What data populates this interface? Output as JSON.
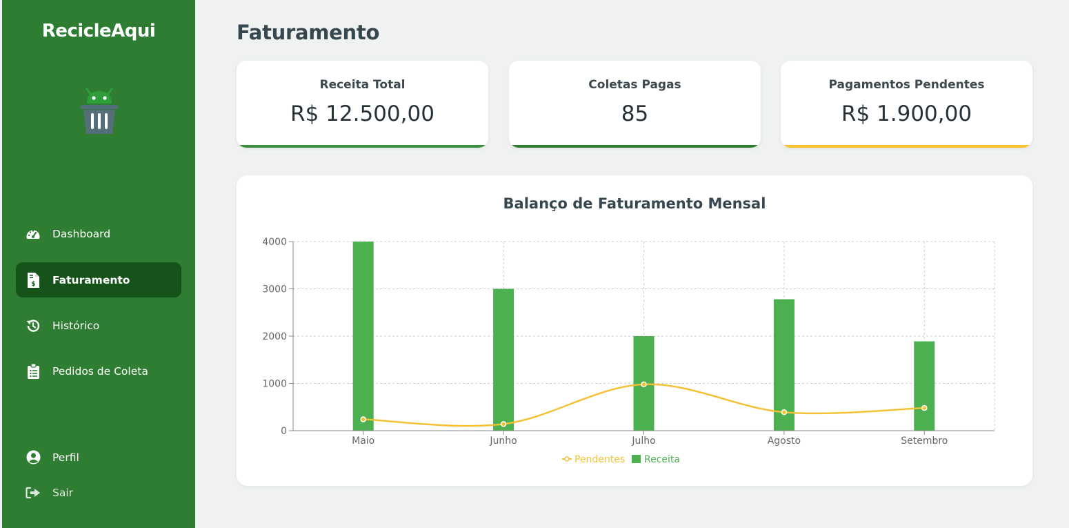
{
  "app": {
    "brand": "RecicleAqui"
  },
  "sidebar": {
    "items": [
      {
        "label": "Dashboard",
        "icon": "gauge-icon"
      },
      {
        "label": "Faturamento",
        "icon": "invoice-icon",
        "active": true
      },
      {
        "label": "Histórico",
        "icon": "history-icon"
      },
      {
        "label": "Pedidos de Coleta",
        "icon": "clipboard-list-icon"
      }
    ],
    "bottom": [
      {
        "label": "Perfil",
        "icon": "user-circle-icon"
      },
      {
        "label": "Sair",
        "icon": "sign-out-icon"
      }
    ]
  },
  "page": {
    "title": "Faturamento"
  },
  "cards": [
    {
      "title": "Receita Total",
      "value": "R$ 12.500,00",
      "accent": "#388e3c"
    },
    {
      "title": "Coletas Pagas",
      "value": "85",
      "accent": "#2e7d32"
    },
    {
      "title": "Pagamentos Pendentes",
      "value": "R$ 1.900,00",
      "accent": "#fbc02d"
    }
  ],
  "chart_data": {
    "type": "bar",
    "title": "Balanço de Faturamento Mensal",
    "categories": [
      "Maio",
      "Junho",
      "Julho",
      "Agosto",
      "Setembro"
    ],
    "series": [
      {
        "name": "Receita",
        "type": "bar",
        "color": "#4caf50",
        "values": [
          4000,
          3000,
          2000,
          2780,
          1890
        ]
      },
      {
        "name": "Pendentes",
        "type": "line",
        "color": "#f4c136",
        "values": [
          240,
          140,
          980,
          390,
          480
        ]
      }
    ],
    "yticks": [
      0,
      1000,
      2000,
      3000,
      4000
    ],
    "ylim": [
      0,
      4000
    ],
    "grid": true,
    "legend": "bottom"
  },
  "colors": {
    "sidebar": "#2e7d32",
    "active": "#16531a",
    "background": "#eff2f1"
  }
}
